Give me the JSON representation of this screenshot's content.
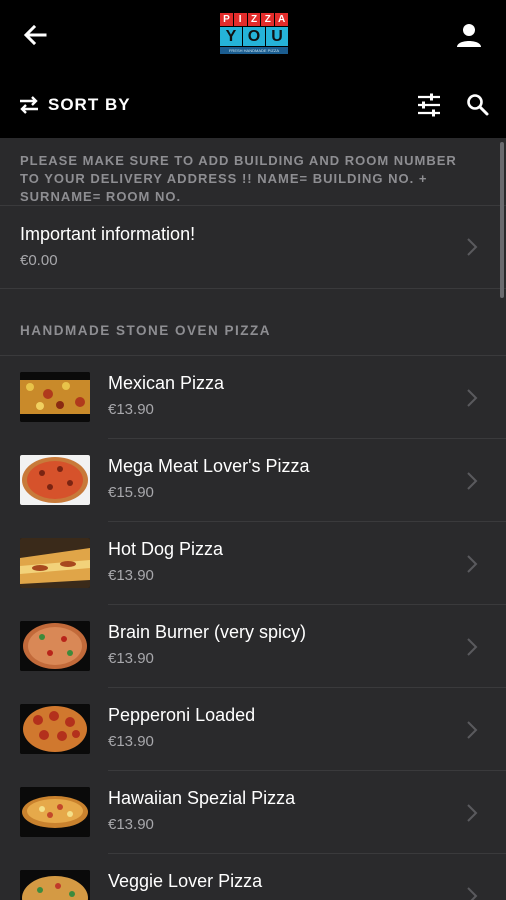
{
  "header": {
    "logo_top": [
      "P",
      "I",
      "Z",
      "Z",
      "A"
    ],
    "logo_mid": [
      "Y",
      "O",
      "U"
    ],
    "logo_tagline": "FRESH HANDMADE PIZZA"
  },
  "toolbar": {
    "sort_label": "SORT BY"
  },
  "notice": {
    "text": "PLEASE MAKE SURE TO ADD BUILDING AND ROOM NUMBER TO YOUR DELIVERY ADDRESS !! NAME= BUILDING NO. + SURNAME= ROOM NO."
  },
  "info_item": {
    "title": "Important information!",
    "price": "€0.00"
  },
  "section": {
    "title": "HANDMADE STONE OVEN PIZZA"
  },
  "items": [
    {
      "name": "Mexican Pizza",
      "price": "€13.90"
    },
    {
      "name": "Mega Meat Lover's Pizza",
      "price": "€15.90"
    },
    {
      "name": "Hot Dog Pizza",
      "price": "€13.90"
    },
    {
      "name": "Brain Burner (very spicy)",
      "price": "€13.90"
    },
    {
      "name": "Pepperoni Loaded",
      "price": "€13.90"
    },
    {
      "name": "Hawaiian Spezial Pizza",
      "price": "€13.90"
    },
    {
      "name": "Veggie Lover Pizza",
      "price": ""
    }
  ],
  "colors": {
    "background": "#2a2a2c",
    "header_bg": "#000000",
    "brand_red": "#e32c2b",
    "brand_blue": "#25b3d8"
  }
}
